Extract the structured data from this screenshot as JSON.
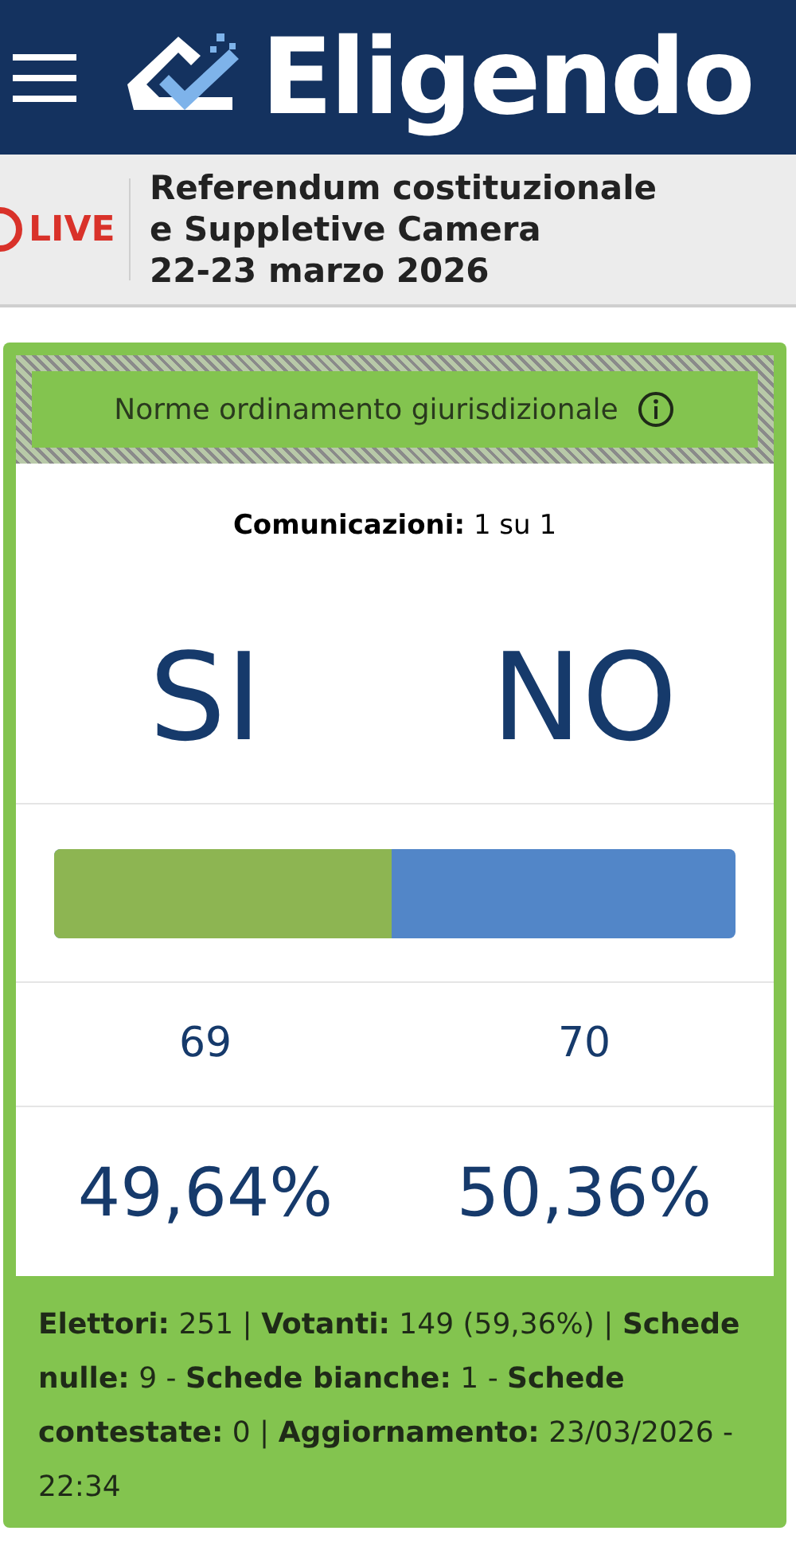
{
  "header": {
    "logo": "Eligendo"
  },
  "banner": {
    "live": "LIVE",
    "title_lines": [
      "Referendum costituzionale",
      "e Suppletive Camera",
      "22-23 marzo 2026"
    ]
  },
  "card": {
    "title": "Norme ordinamento giurisdizionale",
    "communications": "**Comunicazioni:** 1 su 1",
    "options": [
      {
        "label": "SI",
        "votes": "69",
        "percent": "49,64%",
        "color": "#8db552"
      },
      {
        "label": "NO",
        "votes": "70",
        "percent": "50,36%",
        "color": "#5286c8"
      }
    ],
    "bar": {
      "level": 0.4964
    },
    "summary": "**Elettori:** 251 | **Votanti:** 149 (59,36%) | **Schede nulle:** 9 - **Schede bianche:** 1 - **Schede contestate:** 0 | **Aggiornamento:** 23/03/2026 - 22:34"
  }
}
